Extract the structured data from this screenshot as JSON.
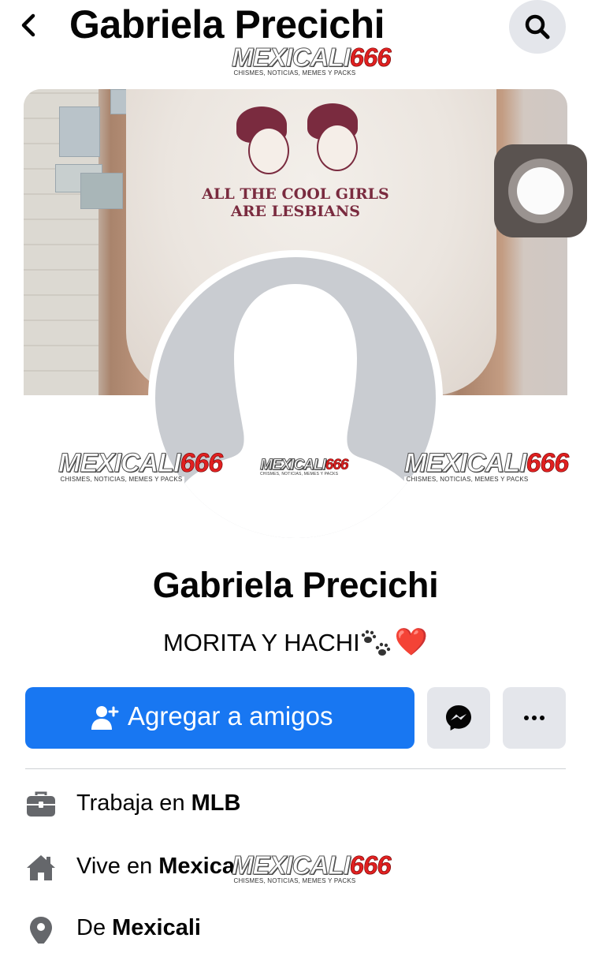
{
  "header": {
    "title": "Gabriela Precichi",
    "back_icon": "chevron-left-icon",
    "search_icon": "search-icon"
  },
  "watermark": {
    "brand_part1": "MEXICALI",
    "brand_part2": "666",
    "tagline": "CHISMES, NOTICIAS, MEMES Y PACKS"
  },
  "cover": {
    "shirt_text_line1": "ALL THE COOL GIRLS",
    "shirt_text_line2": "ARE LESBIANS"
  },
  "profile": {
    "name": "Gabriela Precichi",
    "bio_text": "MORITA Y HACHI",
    "bio_emoji_heart": "❤️"
  },
  "actions": {
    "add_friend_label": "Agregar a amigos",
    "add_friend_icon": "add-user-icon",
    "messenger_icon": "messenger-icon",
    "more_icon": "more-horizontal-icon"
  },
  "info": [
    {
      "icon": "briefcase-icon",
      "prefix": "Trabaja en ",
      "value": "MLB"
    },
    {
      "icon": "home-icon",
      "prefix": "Vive en ",
      "value": "Mexica"
    },
    {
      "icon": "location-pin-icon",
      "prefix": "De ",
      "value": "Mexicali"
    }
  ],
  "colors": {
    "primary_blue": "#1877f2",
    "secondary_button": "#e4e6eb",
    "avatar_placeholder": "#c9ccd1",
    "shirt_print": "#7a2b3f"
  }
}
